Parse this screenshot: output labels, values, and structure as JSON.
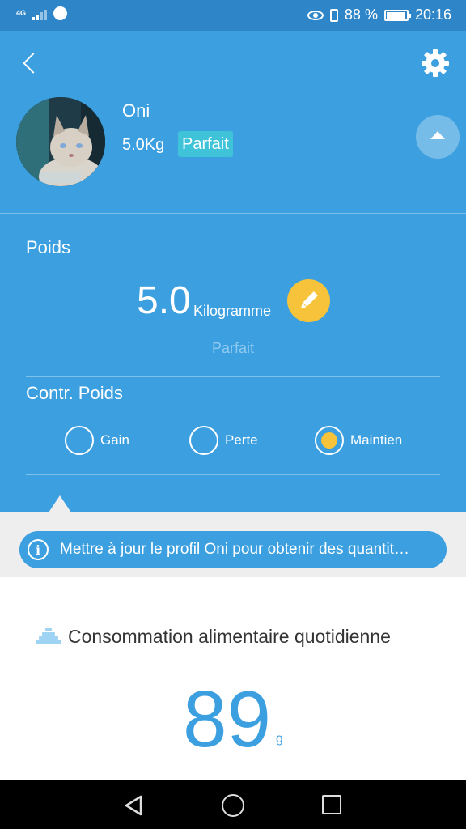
{
  "status_bar": {
    "network": "4G",
    "battery_percent": "88 %",
    "time": "20:16",
    "icons": [
      "signal-icon",
      "messenger-icon",
      "eye-icon",
      "vibrate-icon",
      "battery-icon"
    ]
  },
  "pet": {
    "name": "Oni",
    "weight_short": "5.0Kg",
    "status_badge": "Parfait"
  },
  "weight_section": {
    "title": "Poids",
    "value": "5.0",
    "unit": "Kilogramme",
    "status": "Parfait"
  },
  "weight_control": {
    "title": "Contr. Poids",
    "options": [
      {
        "label": "Gain",
        "selected": false
      },
      {
        "label": "Perte",
        "selected": false
      },
      {
        "label": "Maintien",
        "selected": true
      }
    ]
  },
  "banner": {
    "text": "Mettre à jour le profil Oni pour obtenir des quantit…"
  },
  "food": {
    "title": "Consommation alimentaire quotidienne",
    "value": "89",
    "unit": "g"
  },
  "colors": {
    "primary": "#3b9fe0",
    "status_bar": "#2e86c8",
    "accent": "#f6c33b",
    "badge": "#3fc3d9"
  }
}
